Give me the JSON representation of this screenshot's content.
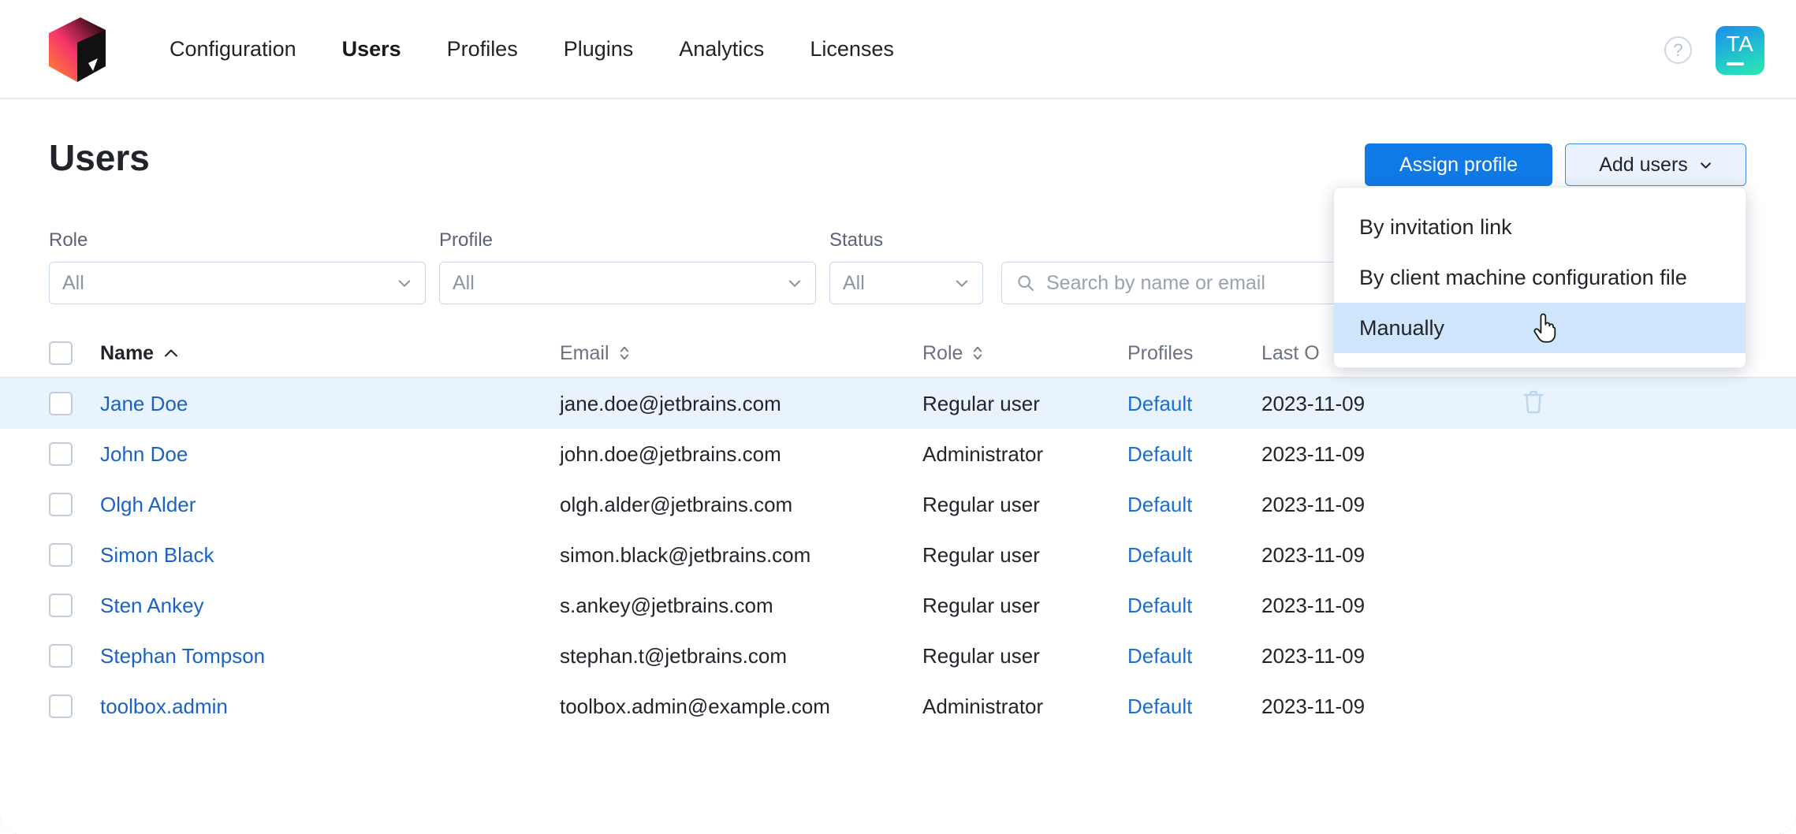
{
  "colors": {
    "accent": "#0f7ae5",
    "link": "#1a63c4",
    "row_highlight": "#e9f3fd",
    "dropdown_highlight": "#cfe5fb",
    "border": "#ccd8e6",
    "avatar_from": "#1a8cf0",
    "avatar_to": "#2ae5b0"
  },
  "topbar": {
    "logo_name": "jetbrains-toolbox-logo",
    "nav": [
      {
        "label": "Configuration",
        "active": false
      },
      {
        "label": "Users",
        "active": true
      },
      {
        "label": "Profiles",
        "active": false
      },
      {
        "label": "Plugins",
        "active": false
      },
      {
        "label": "Analytics",
        "active": false
      },
      {
        "label": "Licenses",
        "active": false
      }
    ],
    "help_icon": "help-circle-icon",
    "help_label": "?",
    "avatar_initials": "TA"
  },
  "page": {
    "title": "Users",
    "assign_profile_label": "Assign profile",
    "add_users_label": "Add users",
    "add_users_chevron": "chevron-down-icon"
  },
  "filters": [
    {
      "label": "Role",
      "value": "All",
      "name": "role"
    },
    {
      "label": "Profile",
      "value": "All",
      "name": "profile"
    },
    {
      "label": "Status",
      "value": "All",
      "name": "status"
    }
  ],
  "search": {
    "placeholder": "Search by name or email",
    "value": "",
    "icon": "search-icon"
  },
  "dropdown": {
    "open": true,
    "items": [
      {
        "label": "By invitation link",
        "active": false
      },
      {
        "label": "By client machine configuration file",
        "active": false
      },
      {
        "label": "Manually",
        "active": true
      }
    ]
  },
  "table": {
    "columns": [
      {
        "label": "Name",
        "sort": "asc",
        "sortable": true
      },
      {
        "label": "Email",
        "sort": "none",
        "sortable": true
      },
      {
        "label": "Role",
        "sort": "none",
        "sortable": true
      },
      {
        "label": "Profiles",
        "sort": null,
        "sortable": false
      },
      {
        "label": "Last O",
        "sort": null,
        "sortable": false
      }
    ],
    "rows": [
      {
        "name": "Jane Doe",
        "email": "jane.doe@jetbrains.com",
        "role": "Regular user",
        "profile": "Default",
        "last_online": "2023-11-09",
        "highlighted": true
      },
      {
        "name": "John Doe",
        "email": "john.doe@jetbrains.com",
        "role": "Administrator",
        "profile": "Default",
        "last_online": "2023-11-09",
        "highlighted": false
      },
      {
        "name": "Olgh Alder",
        "email": "olgh.alder@jetbrains.com",
        "role": "Regular user",
        "profile": "Default",
        "last_online": "2023-11-09",
        "highlighted": false
      },
      {
        "name": "Simon Black",
        "email": "simon.black@jetbrains.com",
        "role": "Regular user",
        "profile": "Default",
        "last_online": "2023-11-09",
        "highlighted": false
      },
      {
        "name": "Sten Ankey",
        "email": "s.ankey@jetbrains.com",
        "role": "Regular user",
        "profile": "Default",
        "last_online": "2023-11-09",
        "highlighted": false
      },
      {
        "name": "Stephan Tompson",
        "email": "stephan.t@jetbrains.com",
        "role": "Regular user",
        "profile": "Default",
        "last_online": "2023-11-09",
        "highlighted": false
      },
      {
        "name": "toolbox.admin",
        "email": "toolbox.admin@example.com",
        "role": "Administrator",
        "profile": "Default",
        "last_online": "2023-11-09",
        "highlighted": false
      }
    ],
    "delete_icon": "trash-icon"
  }
}
